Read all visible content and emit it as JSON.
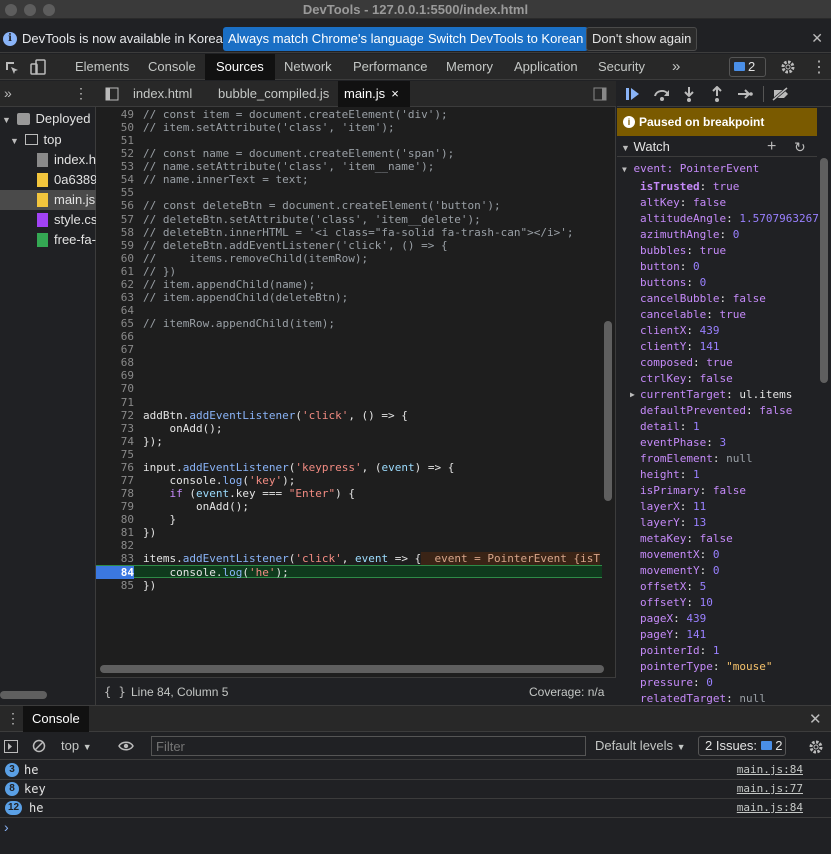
{
  "window": {
    "title": "DevTools - 127.0.0.1:5500/index.html"
  },
  "infobar": {
    "text": "DevTools is now available in Korean!",
    "btn_match": "Always match Chrome's language",
    "btn_switch": "Switch DevTools to Korean",
    "btn_dismiss": "Don't show again",
    "close": "✕"
  },
  "tabs": {
    "elements": "Elements",
    "console": "Console",
    "sources": "Sources",
    "network": "Network",
    "performance": "Performance",
    "memory": "Memory",
    "application": "Application",
    "security": "Security",
    "more": "»",
    "issues_count": "2"
  },
  "sidebar": {
    "deployed": "Deployed",
    "top": "top",
    "files": [
      "index.h",
      "0a6389",
      "main.js",
      "style.cs",
      "free-fa-"
    ]
  },
  "editor": {
    "tabs": [
      "index.html",
      "bubble_compiled.js",
      "main.js"
    ],
    "close": "×",
    "lines": [
      {
        "n": "49",
        "t": "// const item = document.createElement('div');"
      },
      {
        "n": "50",
        "t": "// item.setAttribute('class', 'item');"
      },
      {
        "n": "51",
        "t": ""
      },
      {
        "n": "52",
        "t": "// const name = document.createElement('span');"
      },
      {
        "n": "53",
        "t": "// name.setAttribute('class', 'item__name');"
      },
      {
        "n": "54",
        "t": "// name.innerText = text;"
      },
      {
        "n": "55",
        "t": ""
      },
      {
        "n": "56",
        "t": "// const deleteBtn = document.createElement('button');"
      },
      {
        "n": "57",
        "t": "// deleteBtn.setAttribute('class', 'item__delete');"
      },
      {
        "n": "58",
        "t": "// deleteBtn.innerHTML = '<i class=\"fa-solid fa-trash-can\"></i>';"
      },
      {
        "n": "59",
        "t": "// deleteBtn.addEventListener('click', () => {"
      },
      {
        "n": "60",
        "t": "//     items.removeChild(itemRow);"
      },
      {
        "n": "61",
        "t": "// })"
      },
      {
        "n": "62",
        "t": "// item.appendChild(name);"
      },
      {
        "n": "63",
        "t": "// item.appendChild(deleteBtn);"
      },
      {
        "n": "64",
        "t": ""
      },
      {
        "n": "65",
        "t": "// itemRow.appendChild(item);"
      },
      {
        "n": "66",
        "t": ""
      },
      {
        "n": "67",
        "t": ""
      },
      {
        "n": "68",
        "t": ""
      },
      {
        "n": "69",
        "t": ""
      },
      {
        "n": "70",
        "t": ""
      },
      {
        "n": "71",
        "t": ""
      },
      {
        "n": "72",
        "t": "addBtn.addEventListener('click', () => {"
      },
      {
        "n": "73",
        "t": "    onAdd();"
      },
      {
        "n": "74",
        "t": "});"
      },
      {
        "n": "75",
        "t": ""
      },
      {
        "n": "76",
        "t": "input.addEventListener('keypress', (event) => {"
      },
      {
        "n": "77",
        "t": "    console.log('key');"
      },
      {
        "n": "78",
        "t": "    if (event.key === \"Enter\") {"
      },
      {
        "n": "79",
        "t": "        onAdd();"
      },
      {
        "n": "80",
        "t": "    }"
      },
      {
        "n": "81",
        "t": "})"
      },
      {
        "n": "82",
        "t": ""
      },
      {
        "n": "83",
        "t": "items.addEventListener('click', event => {"
      },
      {
        "n": "84",
        "t": "    console.log('he');"
      },
      {
        "n": "85",
        "t": "})"
      }
    ],
    "inline_value": "event = PointerEvent {isT",
    "status_position": "Line 84, Column 5",
    "status_coverage": "Coverage: n/a",
    "status_braces": "{ }"
  },
  "debugger": {
    "paused": "Paused on breakpoint",
    "watch": "Watch",
    "event_label": "event: PointerEvent",
    "props": [
      {
        "k": "isTrusted",
        "v": "true",
        "type": "bool",
        "bold": true
      },
      {
        "k": "altKey",
        "v": "false",
        "type": "bool"
      },
      {
        "k": "altitudeAngle",
        "v": "1.5707963267",
        "type": "num"
      },
      {
        "k": "azimuthAngle",
        "v": "0",
        "type": "num"
      },
      {
        "k": "bubbles",
        "v": "true",
        "type": "bool"
      },
      {
        "k": "button",
        "v": "0",
        "type": "num"
      },
      {
        "k": "buttons",
        "v": "0",
        "type": "num"
      },
      {
        "k": "cancelBubble",
        "v": "false",
        "type": "bool"
      },
      {
        "k": "cancelable",
        "v": "true",
        "type": "bool"
      },
      {
        "k": "clientX",
        "v": "439",
        "type": "num"
      },
      {
        "k": "clientY",
        "v": "141",
        "type": "num"
      },
      {
        "k": "composed",
        "v": "true",
        "type": "bool"
      },
      {
        "k": "ctrlKey",
        "v": "false",
        "type": "bool"
      },
      {
        "k": "currentTarget",
        "v": "ul.items",
        "type": "obj",
        "expandable": true
      },
      {
        "k": "defaultPrevented",
        "v": "false",
        "type": "bool"
      },
      {
        "k": "detail",
        "v": "1",
        "type": "num"
      },
      {
        "k": "eventPhase",
        "v": "3",
        "type": "num"
      },
      {
        "k": "fromElement",
        "v": "null",
        "type": "null"
      },
      {
        "k": "height",
        "v": "1",
        "type": "num"
      },
      {
        "k": "isPrimary",
        "v": "false",
        "type": "bool"
      },
      {
        "k": "layerX",
        "v": "11",
        "type": "num"
      },
      {
        "k": "layerY",
        "v": "13",
        "type": "num"
      },
      {
        "k": "metaKey",
        "v": "false",
        "type": "bool"
      },
      {
        "k": "movementX",
        "v": "0",
        "type": "num"
      },
      {
        "k": "movementY",
        "v": "0",
        "type": "num"
      },
      {
        "k": "offsetX",
        "v": "5",
        "type": "num"
      },
      {
        "k": "offsetY",
        "v": "10",
        "type": "num"
      },
      {
        "k": "pageX",
        "v": "439",
        "type": "num"
      },
      {
        "k": "pageY",
        "v": "141",
        "type": "num"
      },
      {
        "k": "pointerId",
        "v": "1",
        "type": "num"
      },
      {
        "k": "pointerType",
        "v": "\"mouse\"",
        "type": "str"
      },
      {
        "k": "pressure",
        "v": "0",
        "type": "num"
      },
      {
        "k": "relatedTarget",
        "v": "null",
        "type": "null"
      }
    ]
  },
  "console": {
    "tab": "Console",
    "context": "top",
    "filter_placeholder": "Filter",
    "levels": "Default levels",
    "issues_label": "2 Issues:",
    "issues_count": "2",
    "messages": [
      {
        "count": "3",
        "text": "he",
        "source": "main.js:84"
      },
      {
        "count": "8",
        "text": "key",
        "source": "main.js:77"
      },
      {
        "count": "12",
        "text": "he",
        "source": "main.js:84"
      }
    ],
    "prompt": "›"
  }
}
